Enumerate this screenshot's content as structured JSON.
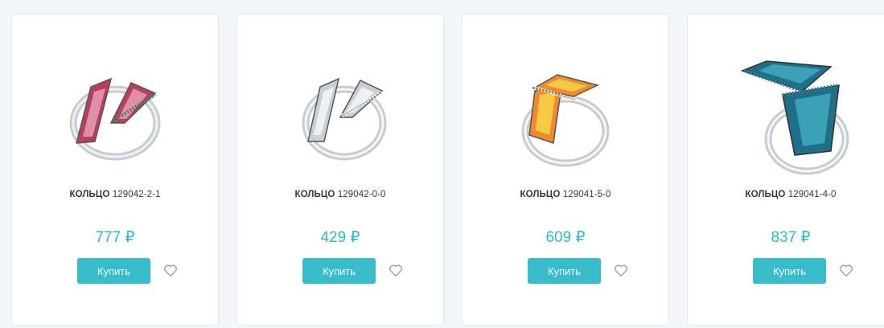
{
  "products": [
    {
      "title_prefix": "КОЛЬЦО",
      "code": "129042-2-1",
      "price": "777 ₽",
      "buy_label": "Купить",
      "colors": {
        "enamel": "#b8405f",
        "enamel_light": "#e08fa6",
        "stones": "#2f8f4a"
      }
    },
    {
      "title_prefix": "КОЛЬЦО",
      "code": "129042-0-0",
      "price": "429 ₽",
      "buy_label": "Купить",
      "colors": {
        "enamel": "#c9ced3",
        "enamel_light": "#eef1f3",
        "stones": "#ffffff"
      }
    },
    {
      "title_prefix": "КОЛЬЦО",
      "code": "129041-5-0",
      "price": "609 ₽",
      "buy_label": "Купить",
      "colors": {
        "enamel": "#f08a2c",
        "enamel_light": "#f7c844",
        "stones": "#ffffff"
      }
    },
    {
      "title_prefix": "КОЛЬЦО",
      "code": "129041-4-0",
      "price": "837 ₽",
      "buy_label": "Купить",
      "colors": {
        "enamel": "#1f6f86",
        "enamel_light": "#3aa1b8",
        "stones": "#2a86a0"
      }
    }
  ],
  "accent_color": "#37bccb",
  "price_color": "#2fb8c8"
}
